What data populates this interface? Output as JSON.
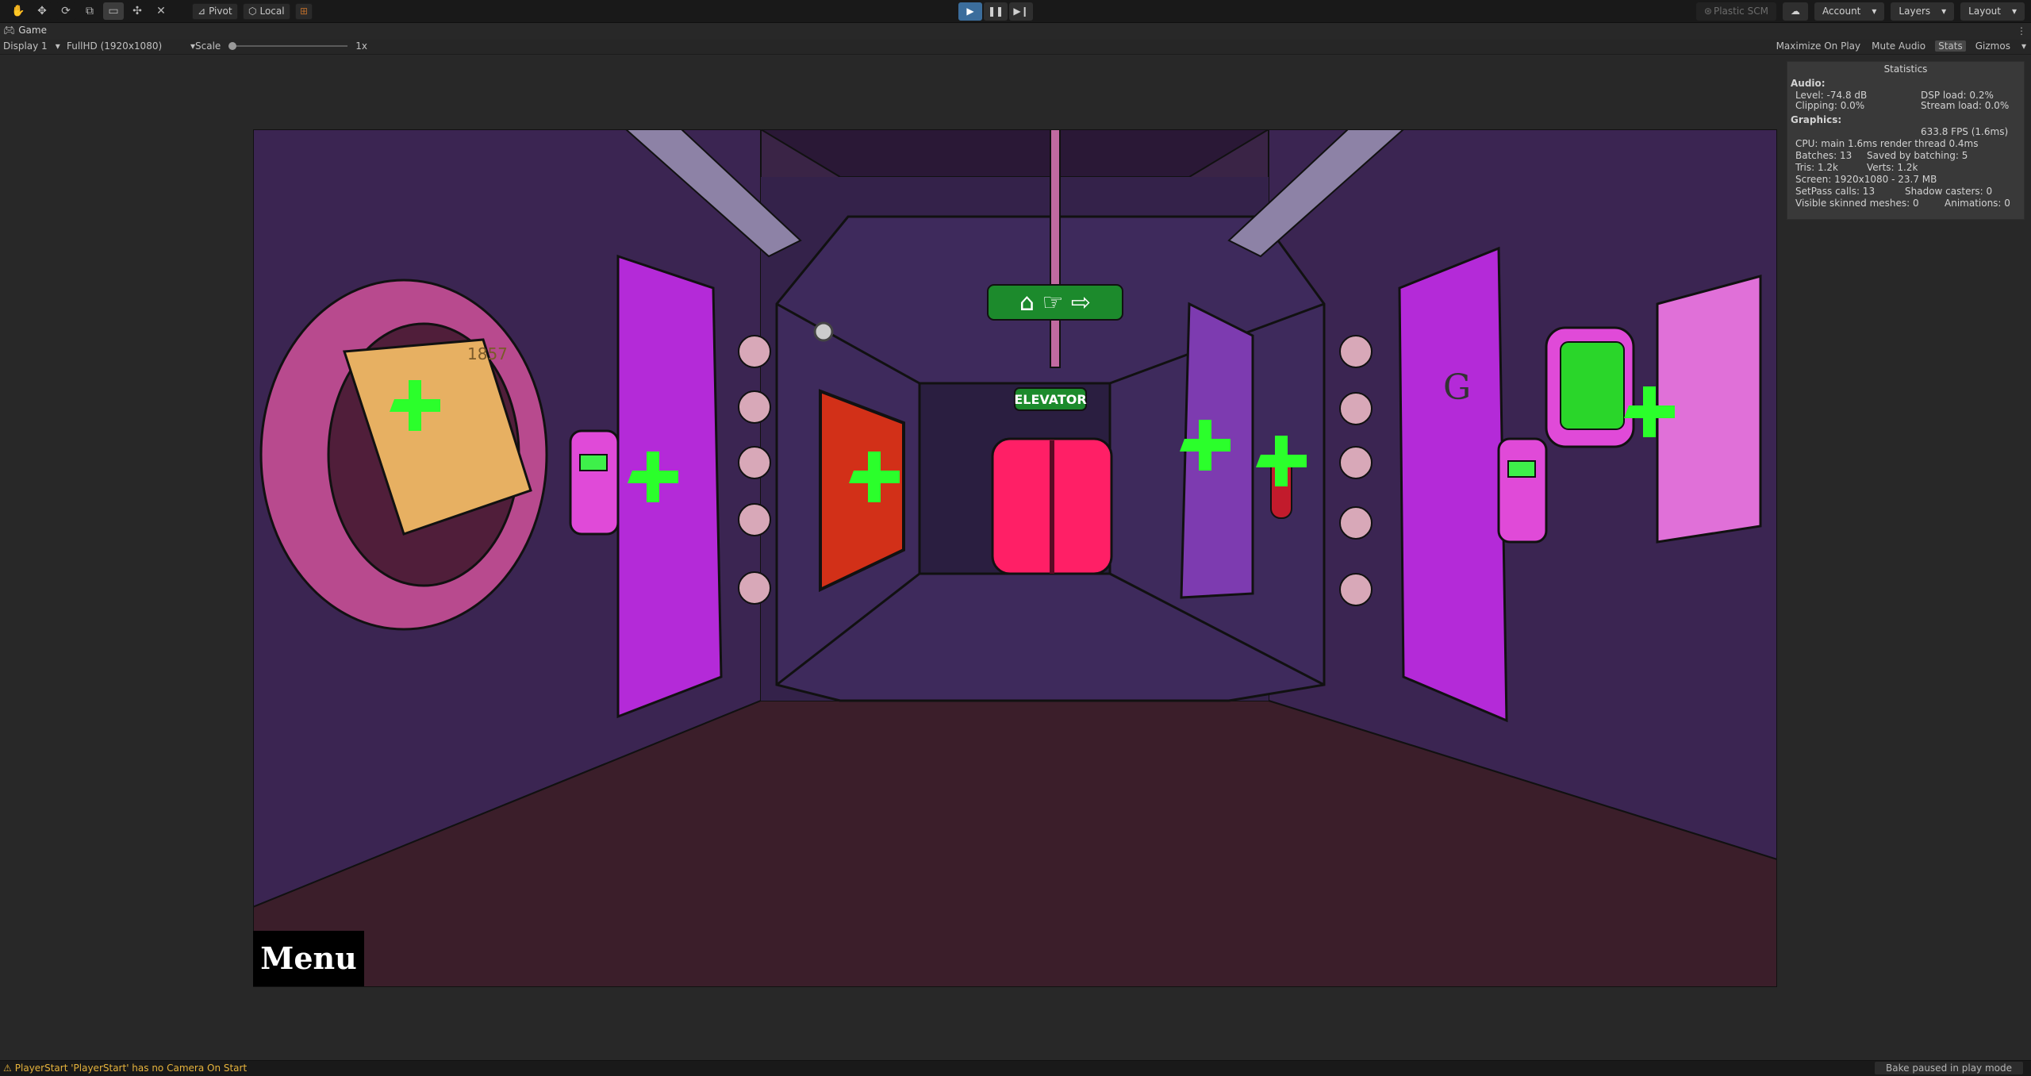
{
  "toolbar": {
    "tools": [
      "hand-icon",
      "move-icon",
      "rotate-icon",
      "scale-icon",
      "rect-icon",
      "transform-icon",
      "custom-tool-icon"
    ],
    "pivot_label": "Pivot",
    "local_label": "Local",
    "plastic_label": "Plastic SCM",
    "account_label": "Account",
    "layers_label": "Layers",
    "layout_label": "Layout"
  },
  "tab": {
    "label": "Game"
  },
  "gamebar": {
    "display": "Display 1",
    "resolution": "FullHD (1920x1080)",
    "scale_label": "Scale",
    "scale_value": "1x",
    "maximize": "Maximize On Play",
    "mute": "Mute Audio",
    "stats": "Stats",
    "gizmos": "Gizmos"
  },
  "game": {
    "menu_label": "Menu",
    "sign_text": "ELEVATOR",
    "poster_text": "1857",
    "door_letter": "G"
  },
  "stats": {
    "title": "Statistics",
    "audio_header": "Audio:",
    "level": "Level: -74.8 dB",
    "clipping": "Clipping: 0.0%",
    "dsp": "DSP load: 0.2%",
    "stream": "Stream load: 0.0%",
    "graphics_header": "Graphics:",
    "fps": "633.8 FPS (1.6ms)",
    "cpu": "CPU: main 1.6ms  render thread 0.4ms",
    "batches": "Batches: 13",
    "saved": "Saved by batching: 5",
    "tris": "Tris: 1.2k",
    "verts": "Verts: 1.2k",
    "screen": "Screen: 1920x1080 - 23.7 MB",
    "setpass": "SetPass calls: 13",
    "shadow": "Shadow casters: 0",
    "skinned": "Visible skinned meshes: 0",
    "animations": "Animations: 0"
  },
  "status": {
    "warning": "PlayerStart 'PlayerStart' has no Camera On Start",
    "bake": "Bake paused in play mode"
  },
  "colors": {
    "accent": "#3b6d9c",
    "warning": "#e6b33c",
    "hotspot": "#2bff2b",
    "door": "#c22fe0"
  }
}
